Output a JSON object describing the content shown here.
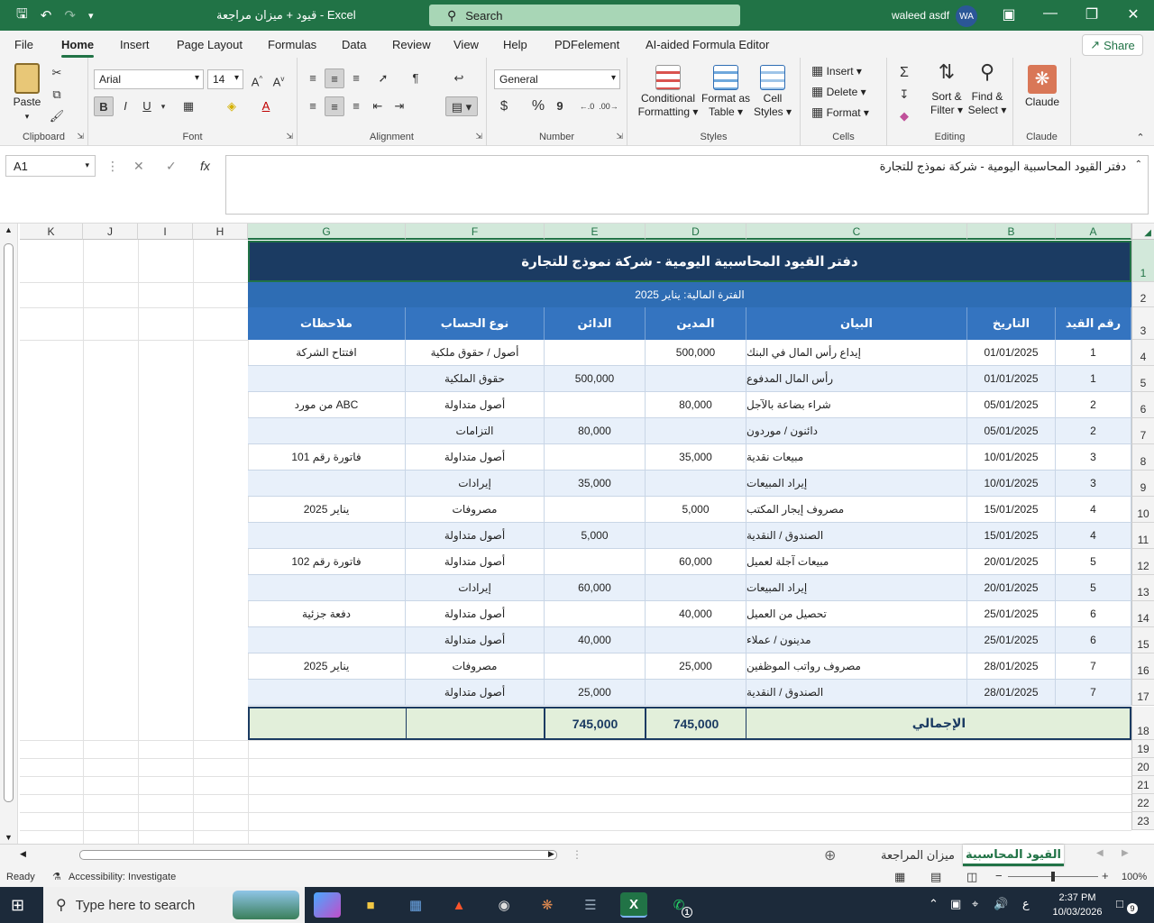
{
  "titlebar": {
    "title": "قيود + ميزان مراجعة  -  Excel",
    "search_label": "Search",
    "user_name": "waleed asdf",
    "user_initials": "WA"
  },
  "menu": {
    "tabs": [
      "File",
      "Home",
      "Insert",
      "Page Layout",
      "Formulas",
      "Data",
      "Review",
      "View",
      "Help",
      "PDFelement",
      "AI-aided Formula Editor"
    ],
    "active_tab": "Home",
    "share_label": "Share"
  },
  "ribbon": {
    "clipboard": {
      "label": "Clipboard",
      "paste": "Paste"
    },
    "font": {
      "label": "Font",
      "font_name": "Arial",
      "font_size": "14",
      "bold": "B",
      "italic": "I",
      "underline": "U"
    },
    "alignment": {
      "label": "Alignment"
    },
    "number": {
      "label": "Number",
      "format": "General",
      "currency": "$",
      "percent": "%",
      "comma": "9"
    },
    "styles": {
      "label": "Styles",
      "conditional_1": "Conditional",
      "conditional_2": "Formatting",
      "format_as_1": "Format as",
      "format_as_2": "Table",
      "cell_styles_1": "Cell",
      "cell_styles_2": "Styles"
    },
    "cells": {
      "label": "Cells",
      "insert": "Insert",
      "delete": "Delete",
      "format": "Format"
    },
    "editing": {
      "label": "Editing",
      "sort_1": "Sort &",
      "sort_2": "Filter",
      "find_1": "Find &",
      "find_2": "Select"
    },
    "claude": {
      "label": "Claude",
      "button": "Claude"
    }
  },
  "formula_bar": {
    "name_box": "A1",
    "fx": "fx",
    "content": "دفتر القيود المحاسبية اليومية - شركة نموذج للتجارة"
  },
  "columns": [
    "K",
    "J",
    "I",
    "H",
    "G",
    "F",
    "E",
    "D",
    "C",
    "B",
    "A"
  ],
  "rows": [
    "1",
    "2",
    "3",
    "4",
    "5",
    "6",
    "7",
    "8",
    "9",
    "10",
    "11",
    "12",
    "13",
    "14",
    "15",
    "16",
    "17",
    "18",
    "19",
    "20",
    "21",
    "22",
    "23"
  ],
  "sheet": {
    "title": "دفتر القيود المحاسبية اليومية - شركة نموذج للتجارة",
    "period": "الفترة المالية: يناير 2025",
    "headers": {
      "entry_no": "رقم القيد",
      "date": "التاريخ",
      "description": "البيان",
      "debit": "المدين",
      "credit": "الدائن",
      "account_type": "نوع الحساب",
      "notes": "ملاحظات"
    },
    "entries": [
      {
        "entry_no": "1",
        "date": "01/01/2025",
        "description": "إيداع رأس المال في البنك",
        "debit": "500,000",
        "credit": "",
        "account_type": "أصول / حقوق ملكية",
        "notes": "افتتاح الشركة"
      },
      {
        "entry_no": "1",
        "date": "01/01/2025",
        "description": "رأس المال المدفوع",
        "debit": "",
        "credit": "500,000",
        "account_type": "حقوق الملكية",
        "notes": ""
      },
      {
        "entry_no": "2",
        "date": "05/01/2025",
        "description": "شراء بضاعة بالآجل",
        "debit": "80,000",
        "credit": "",
        "account_type": "أصول متداولة",
        "notes": "من مورد ABC"
      },
      {
        "entry_no": "2",
        "date": "05/01/2025",
        "description": "دائنون / موردون",
        "debit": "",
        "credit": "80,000",
        "account_type": "التزامات",
        "notes": ""
      },
      {
        "entry_no": "3",
        "date": "10/01/2025",
        "description": "مبيعات نقدية",
        "debit": "35,000",
        "credit": "",
        "account_type": "أصول متداولة",
        "notes": "فاتورة رقم 101"
      },
      {
        "entry_no": "3",
        "date": "10/01/2025",
        "description": "إيراد المبيعات",
        "debit": "",
        "credit": "35,000",
        "account_type": "إيرادات",
        "notes": ""
      },
      {
        "entry_no": "4",
        "date": "15/01/2025",
        "description": "مصروف إيجار المكتب",
        "debit": "5,000",
        "credit": "",
        "account_type": "مصروفات",
        "notes": "يناير 2025"
      },
      {
        "entry_no": "4",
        "date": "15/01/2025",
        "description": "الصندوق / النقدية",
        "debit": "",
        "credit": "5,000",
        "account_type": "أصول متداولة",
        "notes": ""
      },
      {
        "entry_no": "5",
        "date": "20/01/2025",
        "description": "مبيعات آجلة لعميل",
        "debit": "60,000",
        "credit": "",
        "account_type": "أصول متداولة",
        "notes": "فاتورة رقم 102"
      },
      {
        "entry_no": "5",
        "date": "20/01/2025",
        "description": "إيراد المبيعات",
        "debit": "",
        "credit": "60,000",
        "account_type": "إيرادات",
        "notes": ""
      },
      {
        "entry_no": "6",
        "date": "25/01/2025",
        "description": "تحصيل من العميل",
        "debit": "40,000",
        "credit": "",
        "account_type": "أصول متداولة",
        "notes": "دفعة جزئية"
      },
      {
        "entry_no": "6",
        "date": "25/01/2025",
        "description": "مدينون / عملاء",
        "debit": "",
        "credit": "40,000",
        "account_type": "أصول متداولة",
        "notes": ""
      },
      {
        "entry_no": "7",
        "date": "28/01/2025",
        "description": "مصروف رواتب الموظفين",
        "debit": "25,000",
        "credit": "",
        "account_type": "مصروفات",
        "notes": "يناير 2025"
      },
      {
        "entry_no": "7",
        "date": "28/01/2025",
        "description": "الصندوق / النقدية",
        "debit": "",
        "credit": "25,000",
        "account_type": "أصول متداولة",
        "notes": ""
      }
    ],
    "total": {
      "label": "الإجمالي",
      "debit": "745,000",
      "credit": "745,000"
    }
  },
  "sheet_tabs": [
    {
      "name": "القيود المحاسبية",
      "active": true
    },
    {
      "name": "ميزان المراجعة",
      "active": false
    }
  ],
  "status": {
    "ready": "Ready",
    "accessibility": "Accessibility: Investigate",
    "zoom": "100%"
  },
  "taskbar": {
    "search_placeholder": "Type here to search",
    "time": "2:37 PM",
    "date": "10/03/2026",
    "lang": "ع",
    "notifications": "9",
    "whatsapp_badge": "1"
  }
}
